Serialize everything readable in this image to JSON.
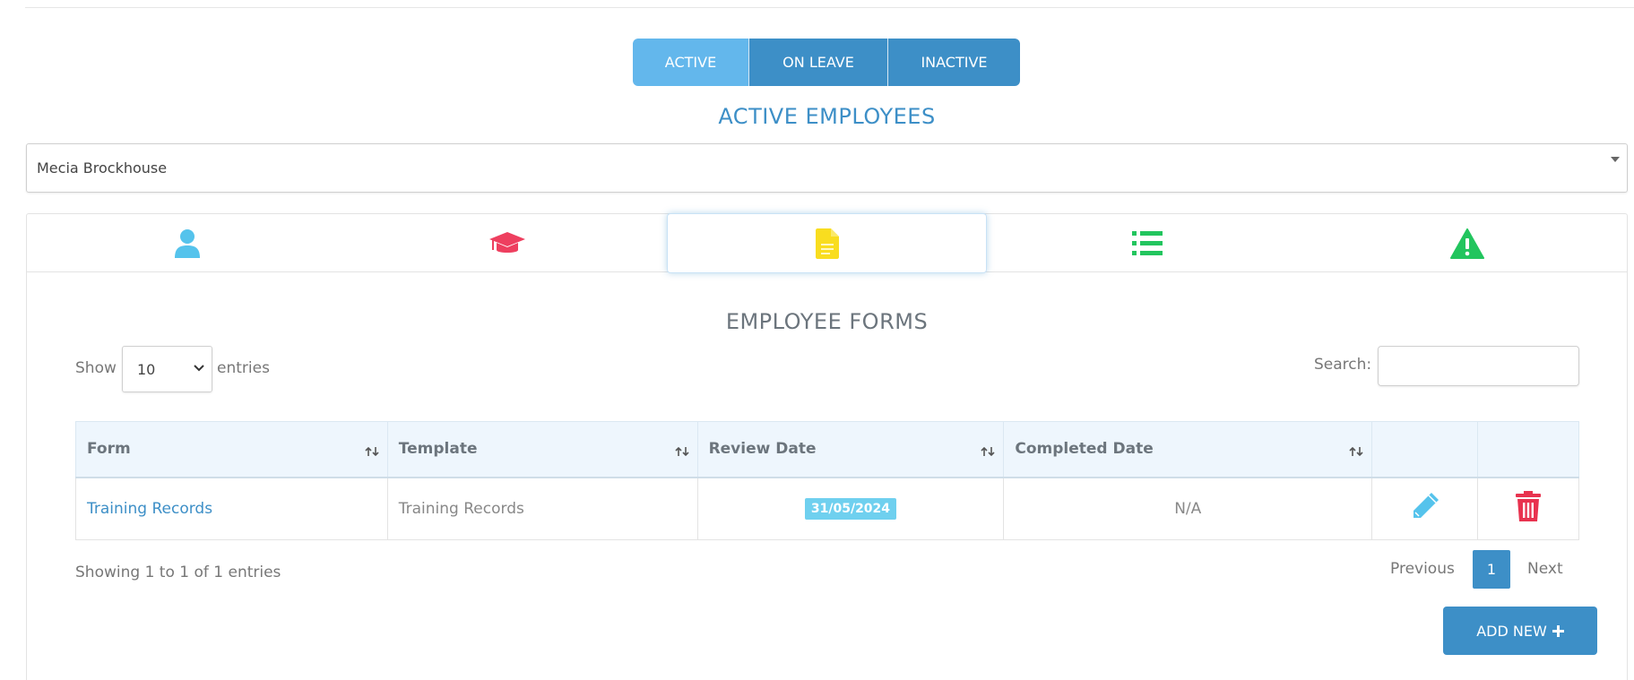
{
  "status_tabs": [
    {
      "label": "ACTIVE",
      "selected": true
    },
    {
      "label": "ON LEAVE",
      "selected": false
    },
    {
      "label": "INACTIVE",
      "selected": false
    }
  ],
  "page_heading": "ACTIVE EMPLOYEES",
  "employee_select": {
    "value": "Mecia Brockhouse"
  },
  "tabs": [
    {
      "icon": "user-icon",
      "color": "#55c3ec"
    },
    {
      "icon": "graduation-cap-icon",
      "color": "#ee3f5f"
    },
    {
      "icon": "document-icon",
      "color": "#f9dd1f",
      "selected": true
    },
    {
      "icon": "list-icon",
      "color": "#22c55e"
    },
    {
      "icon": "warning-icon",
      "color": "#22c55e"
    }
  ],
  "section_title": "EMPLOYEE FORMS",
  "length_control": {
    "show_label": "Show",
    "value": "10",
    "entries_label": "entries"
  },
  "search": {
    "label": "Search:",
    "value": ""
  },
  "table": {
    "columns": [
      "Form",
      "Template",
      "Review Date",
      "Completed Date"
    ],
    "rows": [
      {
        "form": "Training Records",
        "template": "Training Records",
        "review_date": "31/05/2024",
        "completed_date": "N/A"
      }
    ]
  },
  "info_text": "Showing 1 to 1 of 1 entries",
  "pagination": {
    "previous": "Previous",
    "current": "1",
    "next": "Next"
  },
  "add_button": {
    "label": "ADD NEW"
  },
  "colors": {
    "primary": "#3d8fc7",
    "primary_light": "#63b7ec",
    "badge": "#6fd0ef",
    "delete": "#e8334f",
    "edit": "#55c3ec"
  }
}
